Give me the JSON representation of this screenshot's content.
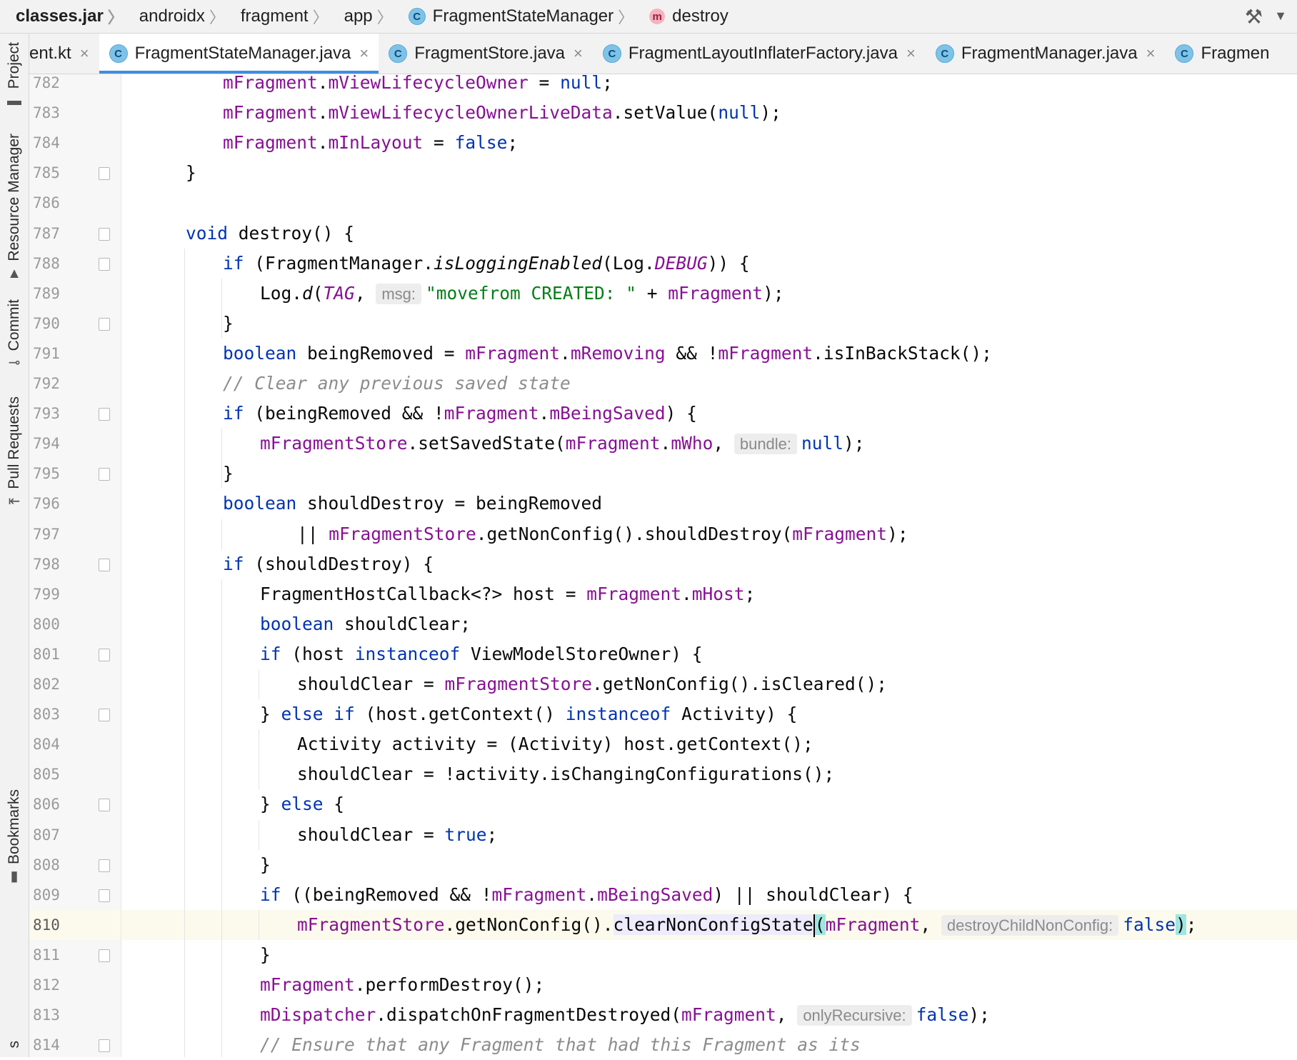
{
  "breadcrumb": {
    "items": [
      "classes.jar",
      "androidx",
      "fragment",
      "app",
      "FragmentStateManager",
      "destroy"
    ],
    "class_icon": "c-class-icon",
    "method_icon": "m-method-icon"
  },
  "toolbar": {
    "build_icon": "hammer-icon",
    "dropdown_icon": "chevron-down-icon"
  },
  "sidebar": {
    "items": [
      {
        "label": "Project",
        "icon": "folder-icon"
      },
      {
        "label": "Resource Manager",
        "icon": "shapes-icon"
      },
      {
        "label": "Commit",
        "icon": "commit-icon"
      },
      {
        "label": "Pull Requests",
        "icon": "pull-request-icon"
      },
      {
        "label": "Bookmarks",
        "icon": "bookmark-icon"
      },
      {
        "label": "s",
        "icon": ""
      }
    ]
  },
  "tabs": [
    {
      "label": "ent.kt",
      "active": false,
      "icon": "none"
    },
    {
      "label": "FragmentStateManager.java",
      "active": true,
      "icon": "c-class-icon"
    },
    {
      "label": "FragmentStore.java",
      "active": false,
      "icon": "c-class-icon"
    },
    {
      "label": "FragmentLayoutInflaterFactory.java",
      "active": false,
      "icon": "c-class-icon"
    },
    {
      "label": "FragmentManager.java",
      "active": false,
      "icon": "c-class-icon"
    },
    {
      "label": "Fragmen",
      "active": false,
      "icon": "c-class-icon"
    }
  ],
  "close_glyph": "×",
  "editor": {
    "line_numbers": [
      "782",
      "783",
      "784",
      "785",
      "786",
      "787",
      "788",
      "789",
      "790",
      "791",
      "792",
      "793",
      "794",
      "795",
      "796",
      "797",
      "798",
      "799",
      "800",
      "801",
      "802",
      "803",
      "804",
      "805",
      "806",
      "807",
      "808",
      "809",
      "810",
      "811",
      "812",
      "813",
      "814"
    ],
    "current_line": "810",
    "hints": {
      "msg": "msg:",
      "bundle": "bundle:",
      "destroyChildNonConfig": "destroyChildNonConfig:",
      "onlyRecursive": "onlyRecursive:"
    }
  }
}
